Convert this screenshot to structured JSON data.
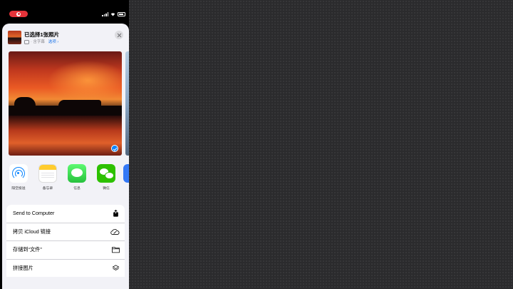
{
  "share_sheet": {
    "title": "已选择1张照片",
    "subtitle": "· 含字幕",
    "options_label": "选项 ›"
  },
  "apps": [
    {
      "label": "隔空投送",
      "icon": "airdrop-icon"
    },
    {
      "label": "备忘录",
      "icon": "notes-icon"
    },
    {
      "label": "信息",
      "icon": "messages-icon"
    },
    {
      "label": "微信",
      "icon": "wechat-icon"
    }
  ],
  "actions": [
    {
      "label": "Send to Computer",
      "icon": "share-box-icon"
    },
    {
      "label": "拷贝 iCloud 链接",
      "icon": "cloud-link-icon"
    },
    {
      "label": "存储到“文件”",
      "icon": "folder-icon"
    },
    {
      "label": "拼接图片",
      "icon": "layers-icon"
    }
  ],
  "colors": {
    "recording_indicator": "#e5333a",
    "link_blue": "#1a73e8",
    "sheet_background": "#f2f2f7"
  }
}
